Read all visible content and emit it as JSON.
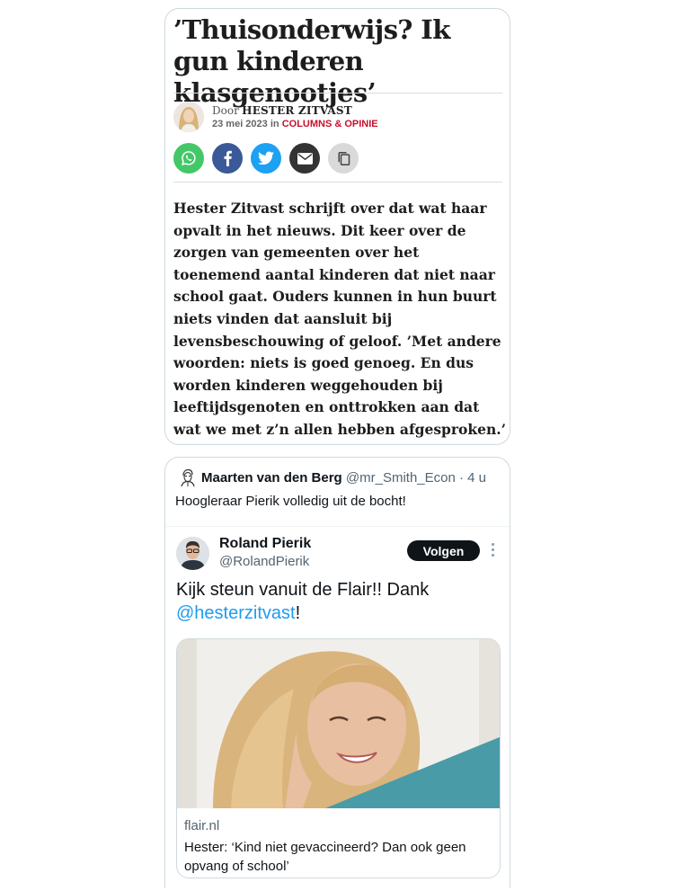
{
  "article": {
    "headline": "’Thuisonderwijs? Ik gun kinderen klasgenootjes’",
    "byline_prefix": "Door",
    "author": "HESTER ZITVAST",
    "date": "23 mei 2023",
    "in_word": "in",
    "category": "COLUMNS & OPINIE",
    "intro": "Hester Zitvast schrijft over dat wat haar opvalt in het nieuws. Dit keer over de zorgen van gemeenten over het toenemend aantal kinderen dat niet naar school gaat. Ouders kunnen in hun buurt niets vinden dat aansluit bij levensbeschouwing of geloof. ’Met andere woorden: niets is goed genoeg. En dus worden kinderen weggehouden bij leeftijdsgenoten en onttrokken aan dat wat we met z’n allen hebben afgesproken.’",
    "share_icons": [
      "whatsapp-icon",
      "facebook-icon",
      "twitter-icon",
      "email-icon",
      "copy-icon"
    ],
    "colors": {
      "category": "#c8102e",
      "whatsapp": "#44c767",
      "facebook": "#3b5998",
      "twitter": "#1da1f2",
      "email": "#333333",
      "copy": "#d9d9d9"
    }
  },
  "tweet": {
    "author_name": "Maarten van den Berg",
    "author_handle": "@mr_Smith_Econ",
    "separator": "·",
    "time": "4 u",
    "text": "Hoogleraar Pierik volledig uit de bocht!",
    "embedded": {
      "author_name": "Roland Pierik",
      "author_handle": "@RolandPierik",
      "follow_label": "Volgen",
      "text_before": "Kijk steun vanuit de Flair!! Dank",
      "mention": "@hesterzitvast",
      "text_after": "!",
      "link": {
        "domain": "flair.nl",
        "title": "Hester: ‘Kind niet gevaccineerd? Dan ook geen opvang of school’"
      }
    },
    "colors": {
      "mention": "#1d9bf0",
      "follow_button": "#0f1419",
      "accent_shape": "#4a9ba8"
    }
  }
}
